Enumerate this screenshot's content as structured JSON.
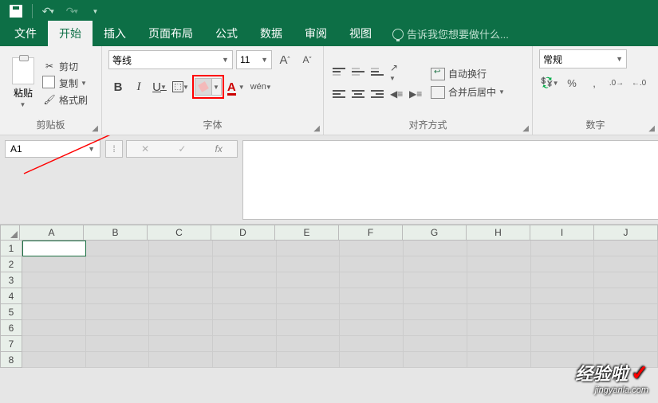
{
  "titlebar": {
    "undo_glyph": "↶",
    "redo_glyph": "↷"
  },
  "tabs": {
    "file": "文件",
    "home": "开始",
    "insert": "插入",
    "layout": "页面布局",
    "formulas": "公式",
    "data": "数据",
    "review": "审阅",
    "view": "视图"
  },
  "tell_me": "告诉我您想要做什么...",
  "clipboard": {
    "paste": "粘贴",
    "cut": "剪切",
    "copy": "复制",
    "format_painter": "格式刷",
    "group_label": "剪贴板"
  },
  "font": {
    "name": "等线",
    "size": "11",
    "bold": "B",
    "italic": "I",
    "underline": "U",
    "increase_A": "A",
    "decrease_A": "A",
    "font_color_A": "A",
    "ruby": "wén",
    "group_label": "字体"
  },
  "align": {
    "wrap": "自动换行",
    "merge": "合并后居中",
    "group_label": "对齐方式"
  },
  "number": {
    "format": "常规",
    "percent": "%",
    "comma": ",",
    "inc_dec1": ".0",
    "inc_dec2": ".00",
    "group_label": "数字"
  },
  "namebox": "A1",
  "fx": {
    "cancel": "✕",
    "enter": "✓",
    "fx": "fx"
  },
  "columns": [
    "A",
    "B",
    "C",
    "D",
    "E",
    "F",
    "G",
    "H",
    "I",
    "J"
  ],
  "rows": [
    "1",
    "2",
    "3",
    "4",
    "5",
    "6",
    "7",
    "8"
  ],
  "watermark": {
    "big": "经验啦",
    "small": "jingyanla.com",
    "check": "✓"
  }
}
